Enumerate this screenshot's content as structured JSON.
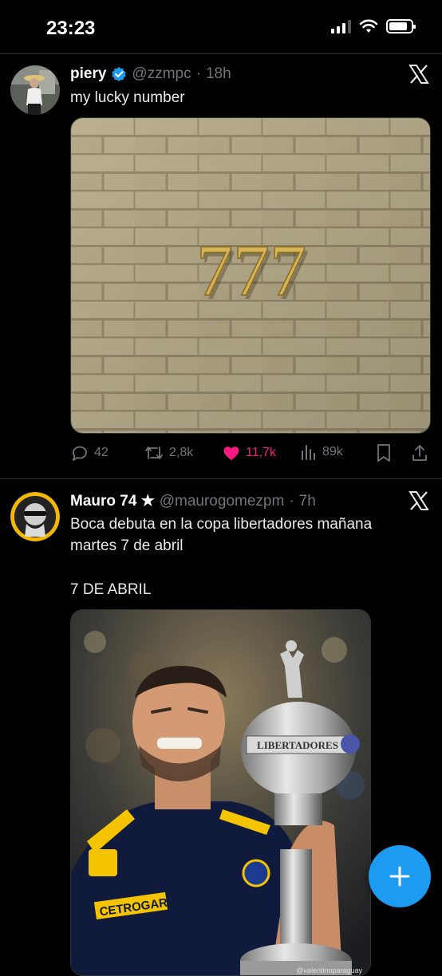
{
  "status_bar": {
    "time": "23:23"
  },
  "tweets": [
    {
      "name": "piery",
      "handle": "@zzmpc",
      "time": "18h",
      "text": "my lucky number",
      "image_text": "777",
      "replies": "42",
      "reposts": "2,8k",
      "likes": "11,7k",
      "views": "89k"
    },
    {
      "name": "Mauro 74 ★",
      "handle": "@maurogomezpm",
      "time": "7h",
      "text": "Boca debuta en la copa libertadores mañana martes 7 de abril",
      "text2": "7 DE ABRIL",
      "image_sponsor": "CETROGAR",
      "image_trophy": "LIBERTADORES",
      "image_watermark": "@valentinoparaguay"
    }
  ],
  "colors": {
    "accent": "#1d9bf0",
    "like": "#f91880",
    "muted": "#71767b",
    "verified": "#1d9bf0"
  },
  "icons": [
    "reply-icon",
    "repost-icon",
    "heart-icon",
    "views-icon",
    "bookmark-icon",
    "share-icon",
    "x-logo-icon",
    "verified-icon",
    "compose-icon"
  ]
}
